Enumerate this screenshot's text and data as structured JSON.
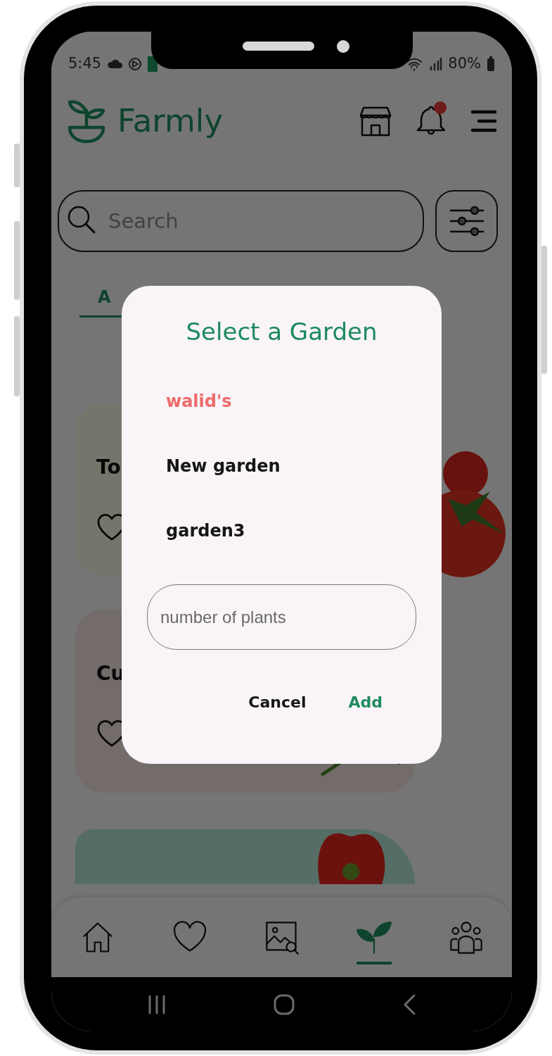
{
  "status_bar": {
    "time": "5:45",
    "battery": "80%"
  },
  "header": {
    "title": "Farmly",
    "notification_unread": true
  },
  "search": {
    "placeholder": "Search"
  },
  "tabs": [
    {
      "label": "A",
      "selected": true
    }
  ],
  "cards": [
    {
      "title": "To",
      "kind": "tomato"
    },
    {
      "title": "Cu",
      "kind": "cucumber"
    },
    {
      "kind": "pepper"
    }
  ],
  "bottom_nav": [
    {
      "kind": "home",
      "selected": false
    },
    {
      "kind": "favorites",
      "selected": false
    },
    {
      "kind": "image-search",
      "selected": false
    },
    {
      "kind": "plant",
      "selected": true
    },
    {
      "kind": "community",
      "selected": false
    }
  ],
  "dialog": {
    "title": "Select a Garden",
    "options": [
      {
        "label": "walid's",
        "selected": true
      },
      {
        "label": "New garden",
        "selected": false
      },
      {
        "label": "garden3",
        "selected": false
      }
    ],
    "input": {
      "placeholder": "number of plants"
    },
    "buttons": [
      {
        "label": "Cancel",
        "kind": "secondary"
      },
      {
        "label": "Add",
        "kind": "primary"
      }
    ]
  }
}
